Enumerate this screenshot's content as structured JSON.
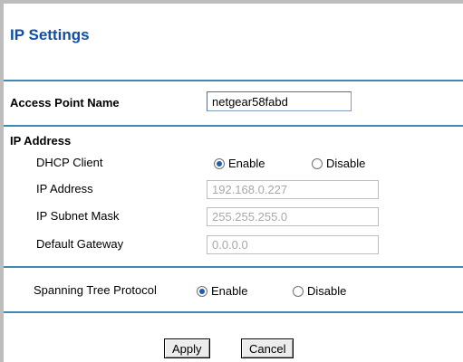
{
  "page": {
    "title": "IP Settings"
  },
  "access_point": {
    "label": "Access Point Name",
    "value": "netgear58fabd"
  },
  "ip_address": {
    "section_label": "IP Address",
    "dhcp_client": {
      "label": "DHCP Client",
      "enable_label": "Enable",
      "disable_label": "Disable",
      "selected": "Enable"
    },
    "ip_address": {
      "label": "IP Address",
      "value": "192.168.0.227"
    },
    "subnet_mask": {
      "label": "IP Subnet Mask",
      "value": "255.255.255.0"
    },
    "default_gateway": {
      "label": "Default Gateway",
      "value": "0.0.0.0"
    }
  },
  "spanning_tree": {
    "label": "Spanning Tree Protocol",
    "enable_label": "Enable",
    "disable_label": "Disable",
    "selected": "Enable"
  },
  "buttons": {
    "apply": "Apply",
    "cancel": "Cancel"
  },
  "colors": {
    "title": "#0f4fa8",
    "divider": "#3f87b5",
    "frame": "#bdbdbd",
    "radio_selected": "#1e5ea8"
  }
}
